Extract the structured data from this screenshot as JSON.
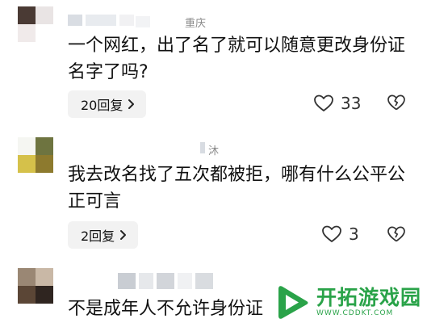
{
  "comments": [
    {
      "region": "重庆",
      "text": "一个网红，出了名了就可以随意更改身份证名字了吗?",
      "reply_label": "20回复",
      "likes": "33"
    },
    {
      "region": "沐",
      "text": "我去改名找了五次都被拒，哪有什么公平公正可言",
      "reply_label": "2回复",
      "likes": "3"
    },
    {
      "region": "",
      "text": "不是成年人不允许身份证"
    }
  ],
  "watermark": {
    "title": "开拓游戏园",
    "url": "WWW.CDDKT.COM"
  },
  "colors": {
    "background": "#ffffff",
    "reply_button_bg": "#f2f2f2",
    "watermark_green": "#2aa349"
  }
}
